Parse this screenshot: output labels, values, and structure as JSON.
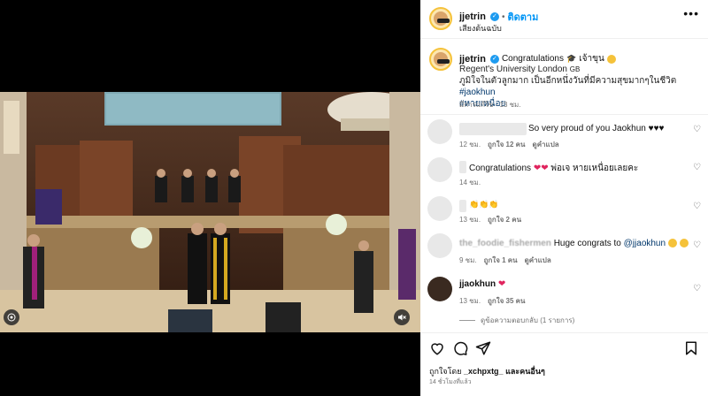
{
  "header": {
    "username": "jjetrin",
    "separator": "•",
    "follow_label": "ติดตาม",
    "audio_label": "เสียงต้นฉบับ",
    "more_icon": "more-horizontal-icon"
  },
  "caption": {
    "username": "jjetrin",
    "text": "Congratulations",
    "suffix": "เจ้าขุน",
    "location": "Regent's University London",
    "location_tag": "GB",
    "body": "ภูมิใจในตัวลูกมาก เป็นอีกหนึ่งวันที่มีความสุขมากๆในชีวิต",
    "hashtag1": "#jaokhun",
    "hashtag2": "#หายเหนื่อย",
    "edited": "มีการแก้ไข · 13 ชม."
  },
  "comments": [
    {
      "text": "So very proud of you Jaokhun ♥♥♥",
      "time": "12 ชม.",
      "likes": "ถูกใจ 12 คน",
      "translate": "ดูคำแปล"
    },
    {
      "text": "Congratulations",
      "text2": "พ่อเจ หายเหนื่อยเลยคะ",
      "time": "14 ชม."
    },
    {
      "text": "👏👏👏",
      "time": "13 ชม.",
      "likes": "ถูกใจ 2 คน"
    },
    {
      "username": "the_foodie_fishermen",
      "text": "Huge congrats to",
      "mention": "@jjaokhun",
      "time": "9 ชม.",
      "likes": "ถูกใจ 1 คน",
      "translate": "ดูคำแปล"
    },
    {
      "username": "jjaokhun",
      "time": "13 ชม.",
      "likes": "ถูกใจ 35 คน"
    }
  ],
  "view_replies": "ดูข้อความตอบกลับ (1 รายการ)",
  "footer": {
    "liked_by_prefix": "ถูกใจโดย",
    "liked_by_user": "_xchpxtg_",
    "liked_by_suffix": "และคนอื่นๆ",
    "time": "14 ชั่วโมงที่แล้ว"
  },
  "colors": {
    "accent": "#0095f6",
    "verified": "#1d9bf0",
    "heart": "#e0245e"
  }
}
